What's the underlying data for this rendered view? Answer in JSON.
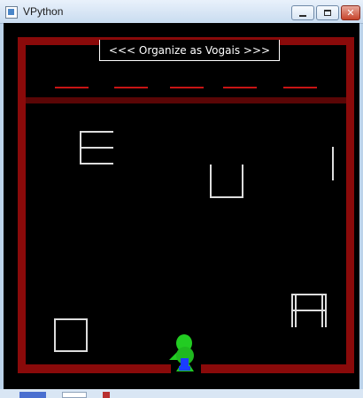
{
  "window": {
    "title": "VPython",
    "icon": "vpython-window-icon",
    "buttons": {
      "minimize_icon": "minimize-icon",
      "maximize_icon": "maximize-icon",
      "close_label": "✕"
    }
  },
  "game": {
    "message": "<<< Organize as Vogais >>>",
    "colors": {
      "background": "#000000",
      "wall": "#8a0a0a",
      "dash": "#c81414",
      "letters": "#dddddd",
      "player_body": "#22cc22",
      "player_accent": "#1a3cff"
    },
    "slot_count": 5,
    "letters": [
      "E",
      "U",
      "I",
      "A",
      "O"
    ],
    "player": "green-robot-player"
  }
}
